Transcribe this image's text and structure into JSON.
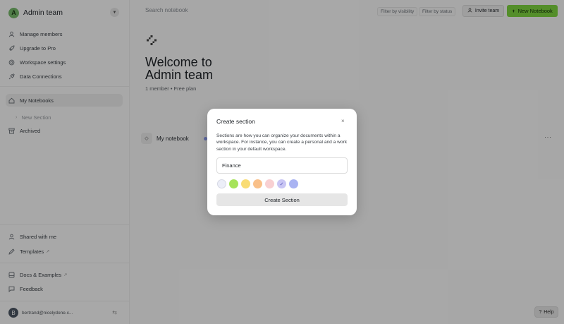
{
  "workspace": {
    "initial": "A",
    "name": "Admin team"
  },
  "sidebar": {
    "top_items": [
      {
        "label": "Manage members",
        "icon": "users-icon"
      },
      {
        "label": "Upgrade to Pro",
        "icon": "rocket-icon"
      },
      {
        "label": "Workspace settings",
        "icon": "gear-icon"
      },
      {
        "label": "Data Connections",
        "icon": "plug-icon"
      }
    ],
    "my_notebooks": "My Notebooks",
    "new_section": "New Section",
    "archived": "Archived",
    "shared_with_me": "Shared with me",
    "templates": "Templates",
    "docs_examples": "Docs & Examples",
    "feedback": "Feedback",
    "external_glyph": "↗"
  },
  "user": {
    "initial": "B",
    "email": "bertrand@nicelydone.c..."
  },
  "topbar": {
    "search_placeholder": "Search notebook",
    "filter_visibility": "Filter by visibility",
    "filter_status": "Filter by status",
    "invite_label": "Invite team",
    "new_notebook_label": "New Notebook"
  },
  "main": {
    "welcome_line1": "Welcome to",
    "welcome_line2": "Admin team",
    "meta": "1 member • Free plan",
    "notebook_title": "My notebook",
    "more_glyph": "···"
  },
  "help_label": "Help",
  "modal": {
    "title": "Create section",
    "close_glyph": "×",
    "description": "Sections are how you can organize your documents within a workspace. For instance, you can create a personal and a work section in your default workspace.",
    "input_value": "Finance",
    "swatches": [
      "#eceef8",
      "#a6e35a",
      "#f9dc74",
      "#f9c089",
      "#f8d0d2",
      "#c9c6f4",
      "#a9b3f2"
    ],
    "selected_swatch_index": 5,
    "check_glyph": "✓",
    "create_label": "Create Section"
  }
}
